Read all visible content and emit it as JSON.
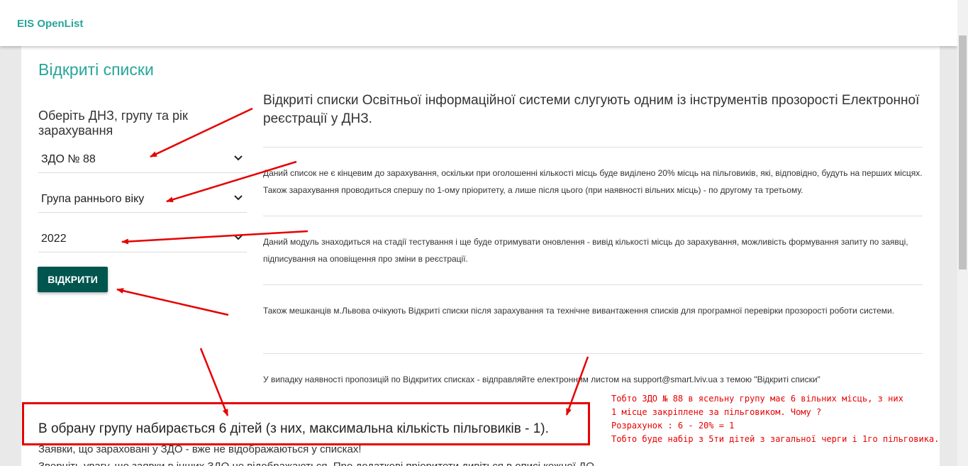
{
  "app": {
    "brand": "EIS OpenList"
  },
  "sidebar": {
    "title": "Відкриті списки",
    "select_heading": "Оберіть ДНЗ, групу та рік зарахування",
    "selects": {
      "kindergarten": "ЗДО № 88",
      "group": "Група раннього віку",
      "year": "2022"
    },
    "open_button": "ВІДКРИТИ"
  },
  "main": {
    "intro": "Відкриті списки Освітньої інформаційної системи слугують одним із інструментів прозорості Електронної реєстрації у ДНЗ.",
    "paragraphs": [
      "Даний список не є кінцевим до зарахування, оскільки при оголошенні кількості місць буде виділено 20% місць на пільговиків, які, відповідно, будуть на перших місцях. Також зарахування проводиться спершу по 1-ому пріоритету, а лише після цього (при наявності вільних місць) - по другому та третьому.",
      "Даний модуль знаходиться на стадії тестування і ще буде отримувати оновлення - вивід кількості місць до зарахування, можливість формування запиту по заявці, підписування на оповіщення про зміни в реєстрації.",
      "Також мешканців м.Львова очікують Відкриті списки після зарахування та технічне вивантаження списків для програмної перевірки прозорості роботи системи.",
      "У випадку наявності пропозицій по Відкритих списках - відправляйте електронним листом на support@smart.lviv.ua з темою \"Відкриті списки\""
    ]
  },
  "result": {
    "summary": "В обрану групу набирається 6 дітей (з них, максимальна кількість пільговиків - 1).",
    "line1": "Заявки, що зараховані у ЗДО - вже не відображаються у списках!",
    "line2": "Зверніть увагу, що заявки в інших ЗДО не відображаються. Про додаткові пріоритети дивіться в описі кожної ДО"
  },
  "annotation": {
    "lines": [
      "Тобто ЗДО № 88 в ясельну групу має 6 вільних місць, з них",
      "1 місце закріплене за пільговиком. Чому ?",
      "Розрахунок : 6 - 20% = 1",
      "Тобто буде набір з 5ти дітей з загальної черги і 1го пільговика."
    ]
  },
  "colors": {
    "accent": "#26a69a",
    "button": "#00564f",
    "annotation": "#e60000"
  }
}
